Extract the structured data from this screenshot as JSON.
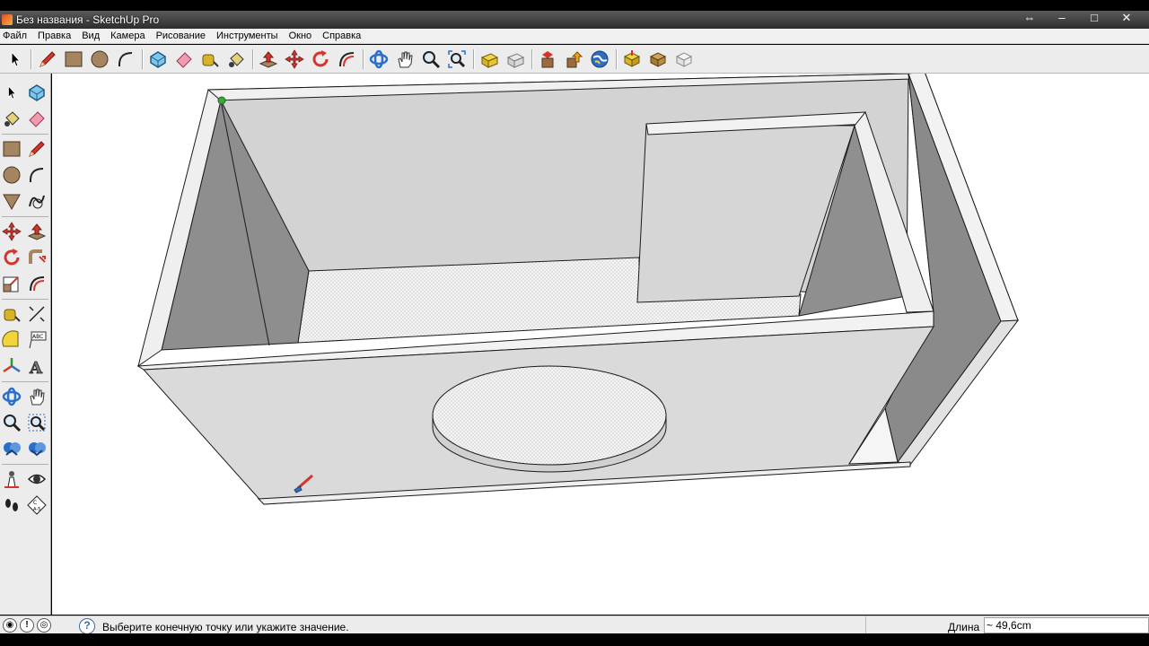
{
  "window": {
    "title": "Без названия - SketchUp Pro",
    "controls": [
      "restore-alt-icon",
      "minimize-icon",
      "maximize-icon",
      "close-icon"
    ]
  },
  "menu": {
    "items": [
      "Файл",
      "Правка",
      "Вид",
      "Камера",
      "Рисование",
      "Инструменты",
      "Окно",
      "Справка"
    ]
  },
  "toolbar": {
    "groups": [
      [
        "select-icon"
      ],
      [
        "pencil-icon",
        "rectangle-icon",
        "circle-icon",
        "arc-icon"
      ],
      [
        "make-component-icon",
        "eraser-icon",
        "tape-measure-icon",
        "paint-bucket-icon"
      ],
      [
        "push-pull-icon",
        "move-icon",
        "rotate-icon",
        "offset-icon"
      ],
      [
        "orbit-icon",
        "pan-icon",
        "zoom-icon",
        "zoom-extents-icon"
      ],
      [
        "get-models-icon",
        "share-model-icon"
      ],
      [
        "get-components-icon",
        "share-component-icon",
        "google-earth-icon"
      ],
      [
        "extension-warehouse-icon",
        "layout-icon",
        "style-builder-icon"
      ]
    ]
  },
  "left_toolbar": {
    "tools": [
      "select-icon",
      "make-component-icon",
      "paint-bucket-icon",
      "eraser-icon",
      "rectangle-icon",
      "pencil-icon",
      "circle-icon",
      "arc-icon",
      "polygon-icon",
      "freehand-icon",
      "move-icon",
      "push-pull-icon",
      "rotate-icon",
      "follow-me-icon",
      "scale-icon",
      "offset-icon",
      "tape-measure-icon",
      "dimensions-icon",
      "protractor-icon",
      "text-icon",
      "axes-icon",
      "3d-text-icon",
      "orbit-icon",
      "pan-icon",
      "zoom-icon",
      "zoom-window-icon",
      "previous-view-icon",
      "zoom-extents-icon",
      "position-camera-icon",
      "look-around-icon",
      "walk-icon",
      "section-plane-icon"
    ]
  },
  "status": {
    "icons": [
      "geo-location-icon",
      "credits-icon",
      "user-icon"
    ],
    "help_icon": "help-icon",
    "message": "Выберите конечную точку или укажите значение.",
    "vcb_label": "Длина",
    "vcb_value": "~ 49,6cm"
  },
  "colors": {
    "viewport_bg": "#ffffff",
    "face_light": "#e2e2e2",
    "face_mid": "#cfcfcf",
    "face_dark": "#8f8f8f",
    "edge": "#1a1a1a",
    "endpoint_marker": "#3aa83a"
  }
}
